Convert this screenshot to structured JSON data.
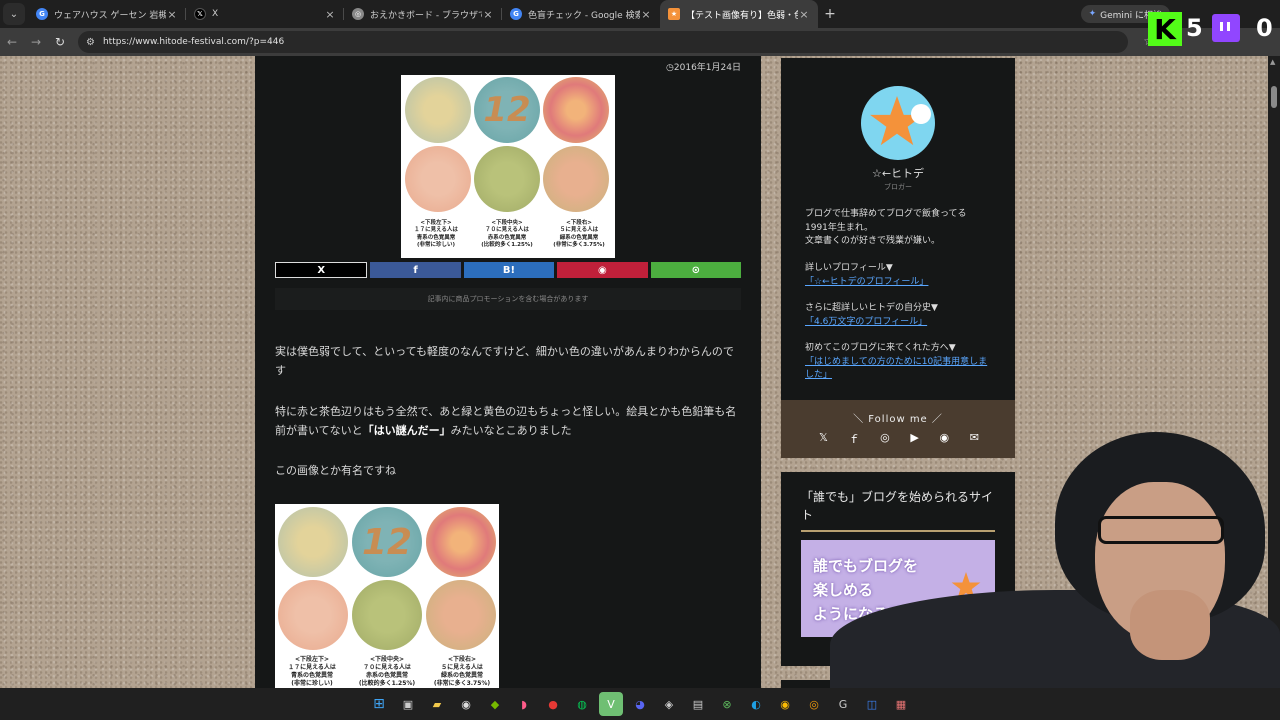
{
  "browser": {
    "tabs": [
      {
        "title": "ウェアハウス ゲーセン 岩槻 - Google 検索",
        "favicon": "google",
        "active": false
      },
      {
        "title": "X",
        "favicon": "x",
        "active": false
      },
      {
        "title": "おえかきボード - ブラウザでかんたん お絵かき",
        "favicon": "chrome",
        "active": false
      },
      {
        "title": "色盲チェック - Google 検索",
        "favicon": "google",
        "active": false
      },
      {
        "title": "【テスト画像有り】色弱・色盲の僕が",
        "favicon": "star",
        "active": true
      }
    ],
    "new_tab_label": "+",
    "gemini_label": "Gemini に相談",
    "url": "https://www.hitode-festival.com/?p=446"
  },
  "overlay": {
    "kick_letter": "K",
    "kick_count": "5",
    "twitch_count": "0"
  },
  "article": {
    "date": "2016年1月24日",
    "plate_numbers": [
      "12"
    ],
    "captions": [
      "<下段左下>\n１７に見える人は\n青系の色覚異常\n(非常に珍しい)",
      "<下段中央>\n７０に見える人は\n赤系の色覚異常\n(比較的多く1.25%)",
      "<下段右>\n５に見える人は\n緑系の色覚異常\n(非常に多く3.75%)"
    ],
    "share_buttons": [
      "X",
      "f",
      "B!",
      "◉",
      "⊙"
    ],
    "promo_notice": "記事内に商品プロモーションを含む場合があります",
    "para1": "実は僕色弱でして、といっても軽度のなんですけど、細かい色の違いがあんまりわからんのです",
    "para2_before": "特に赤と茶色辺りはもう全然で、あと緑と黄色の辺もちょっと怪しい。絵具とかも色鉛筆も名前が書いてないと",
    "para2_bold": "「はい謎んだー」",
    "para2_after": "みたいなとこありました",
    "para3": "この画像とか有名ですね"
  },
  "sidebar": {
    "name": "☆←ヒトデ",
    "role": "ブロガー",
    "bio_line1": "ブログで仕事辞めてブログで飯食ってる",
    "bio_line2": "1991年生まれ。",
    "bio_line3": "文章書くのが好きで残業が嫌い。",
    "link1_label": "詳しいプロフィール▼",
    "link1_text": "「☆←ヒトデのプロフィール」",
    "link2_label": "さらに超詳しいヒトデの自分史▼",
    "link2_text": "「4.6万文字のプロフィール」",
    "link3_label": "初めてこのブログに来てくれた方へ▼",
    "link3_text": "「はじめましての方のために10記事用意しました」",
    "follow_title": "＼ Follow me ／",
    "promo_heading": "「誰でも」ブログを始められるサイト",
    "banner_line1": "誰でもブログを",
    "banner_line2": "楽しめる",
    "banner_line3": "ようになるサイト"
  }
}
